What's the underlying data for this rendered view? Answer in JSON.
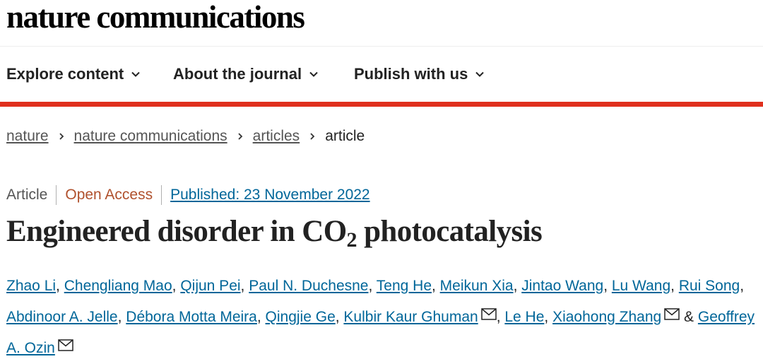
{
  "site": {
    "logo": "nature communications"
  },
  "nav": [
    {
      "label": "Explore content"
    },
    {
      "label": "About the journal"
    },
    {
      "label": "Publish with us"
    }
  ],
  "breadcrumb": {
    "items": [
      "nature",
      "nature communications",
      "articles"
    ],
    "current": "article"
  },
  "article": {
    "type": "Article",
    "access": "Open Access",
    "published": "Published: 23 November 2022",
    "title_before": "Engineered disorder in CO",
    "title_sub": "2",
    "title_after": " photocatalysis"
  },
  "authors": {
    "list": [
      "Zhao Li",
      "Chengliang Mao",
      "Qijun Pei",
      "Paul N. Duchesne",
      "Teng He",
      "Meikun Xia",
      "Jintao Wang",
      "Lu Wang",
      "Rui Song",
      "Abdinoor A. Jelle",
      "Débora Motta Meira",
      "Qingjie Ge",
      "Kulbir Kaur Ghuman",
      "Le He",
      "Xiaohong Zhang",
      "Geoffrey A. Ozin"
    ],
    "sep": ", ",
    "amp": " & "
  },
  "colors": {
    "accent_red": "#e0301e",
    "link_blue": "#006699",
    "open_access": "#b0512d"
  },
  "icons": {
    "nav_chevron": "chevron-down-icon",
    "crumb_sep": "chevron-right-icon",
    "email": "envelope-icon"
  }
}
